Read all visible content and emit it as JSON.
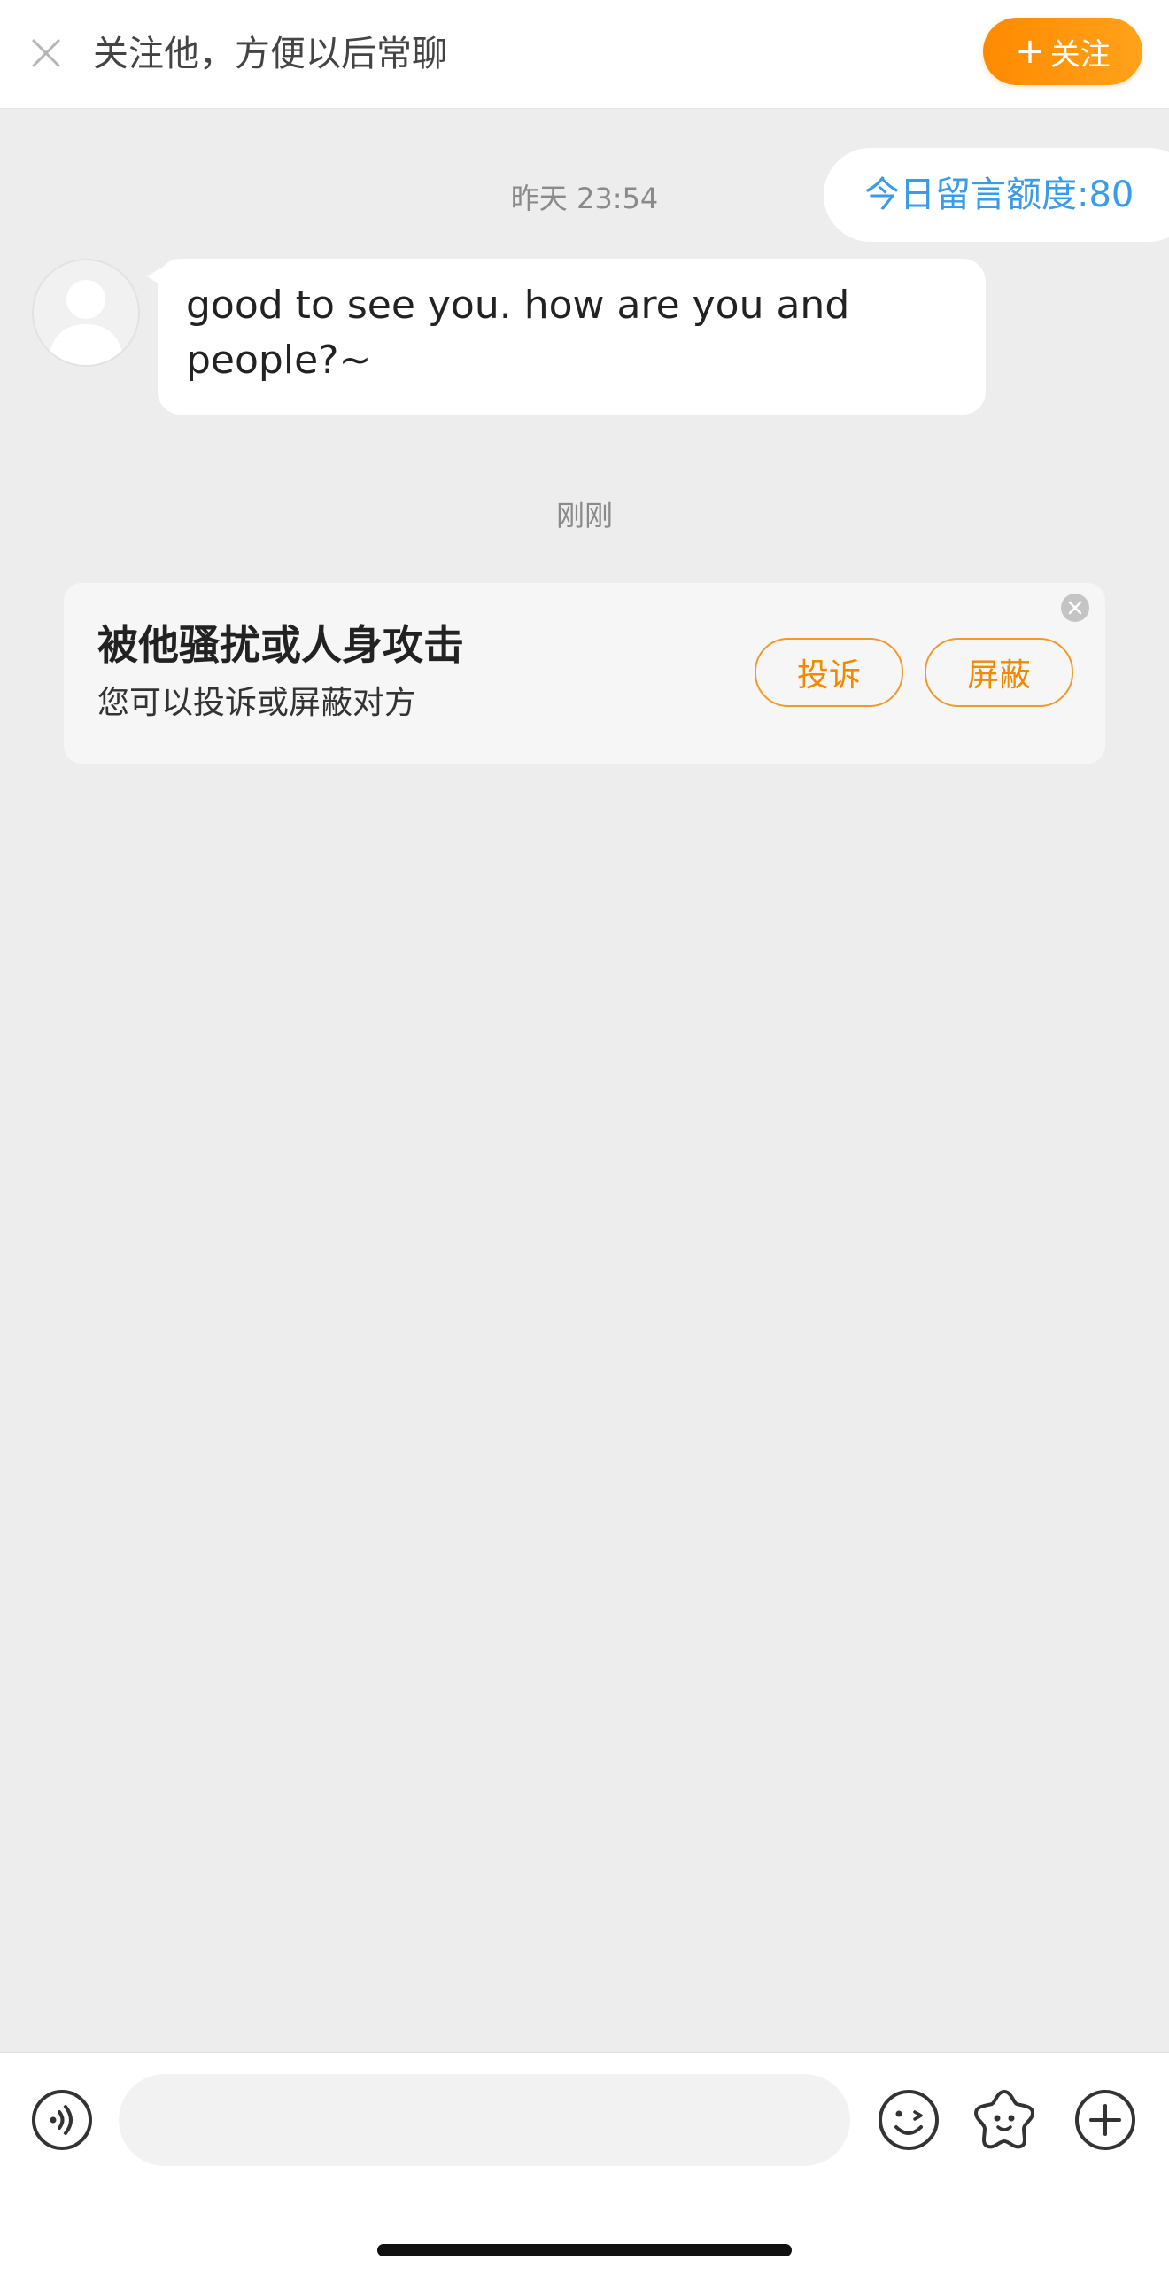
{
  "header": {
    "prompt": "关注他，方便以后常聊",
    "follow_plus": "+",
    "follow_label": "关注"
  },
  "quota": {
    "text": "今日留言额度:80"
  },
  "chat": {
    "timestamp_1": "昨天 23:54",
    "message_1": "good to see you. how are you and people?~",
    "timestamp_2": "刚刚"
  },
  "safety_card": {
    "title": "被他骚扰或人身攻击",
    "subtitle": "您可以投诉或屏蔽对方",
    "complain_label": "投诉",
    "block_label": "屏蔽"
  },
  "composer": {
    "input_value": "",
    "icons": [
      "voice-icon",
      "emoji-icon",
      "sticker-icon",
      "plus-icon"
    ]
  },
  "colors": {
    "accent_orange": "#ff8a00",
    "link_blue": "#3a9be8",
    "background": "#ededed"
  }
}
